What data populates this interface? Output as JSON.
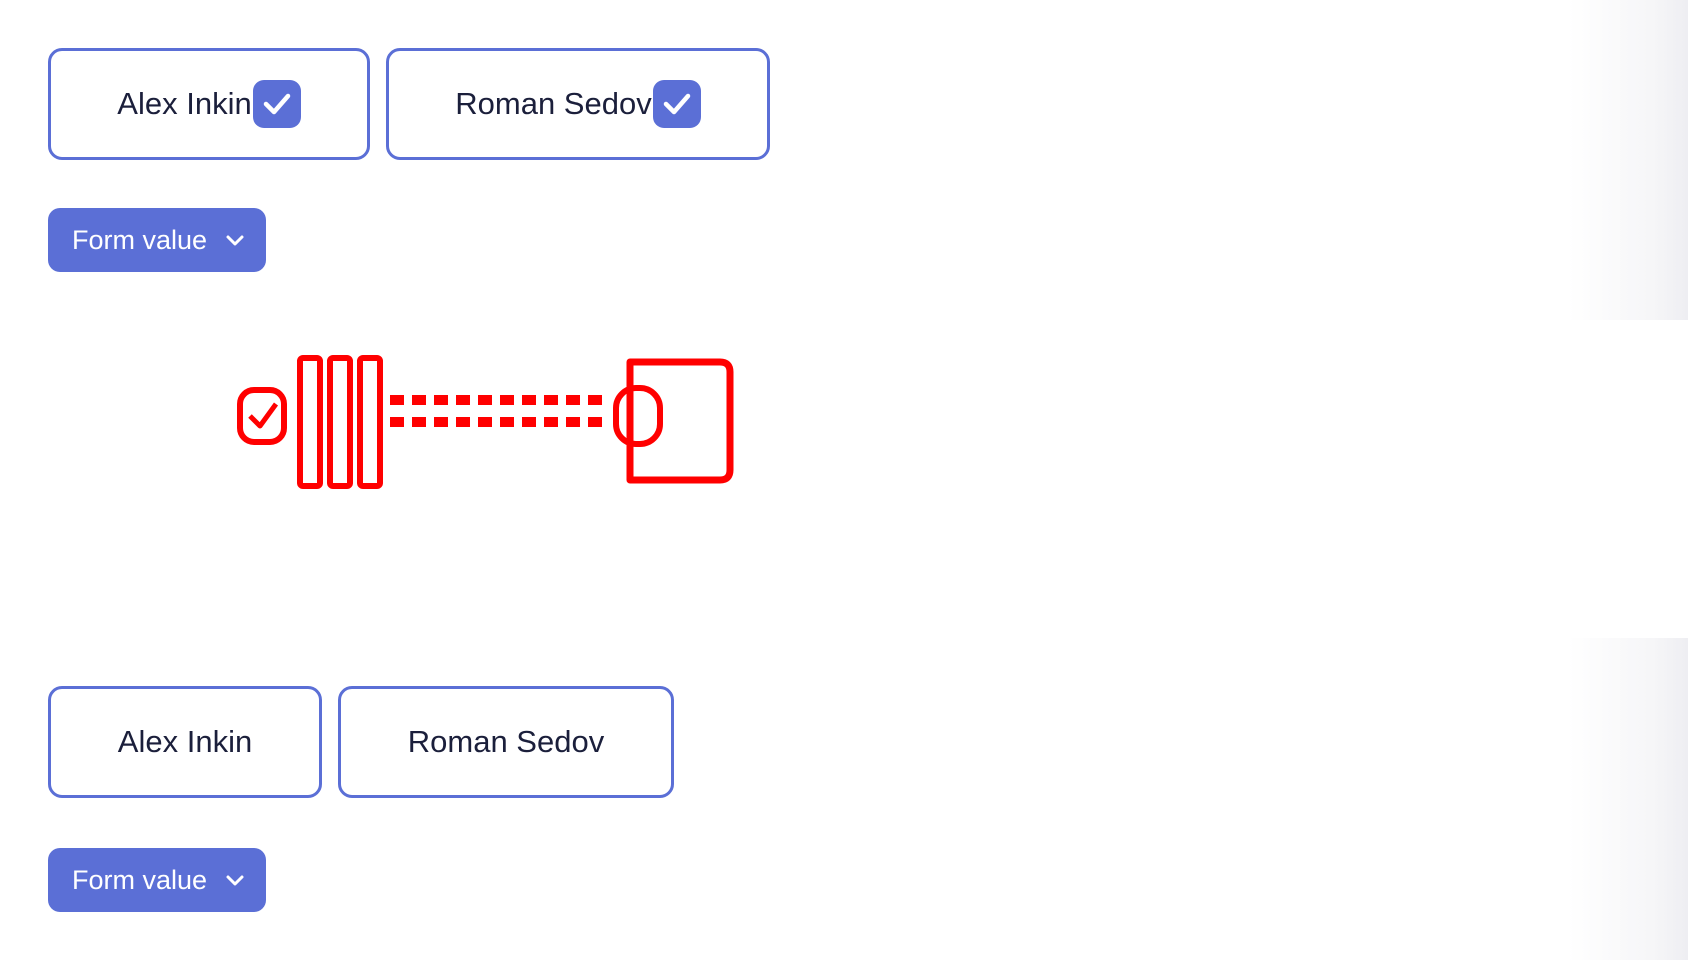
{
  "colors": {
    "accent": "#5b6fd6",
    "text": "#1b1f3b",
    "artifact": "#ff0000"
  },
  "top_panel": {
    "chips": [
      {
        "label": "Alex Inkin",
        "checked": true
      },
      {
        "label": "Roman Sedov",
        "checked": true
      }
    ],
    "dropdown": {
      "label": "Form value",
      "icon": "chevron-down-icon"
    }
  },
  "bottom_panel": {
    "chips": [
      {
        "label": "Alex Inkin",
        "checked": false
      },
      {
        "label": "Roman Sedov",
        "checked": false
      }
    ],
    "dropdown": {
      "label": "Form value",
      "icon": "chevron-down-icon"
    }
  }
}
